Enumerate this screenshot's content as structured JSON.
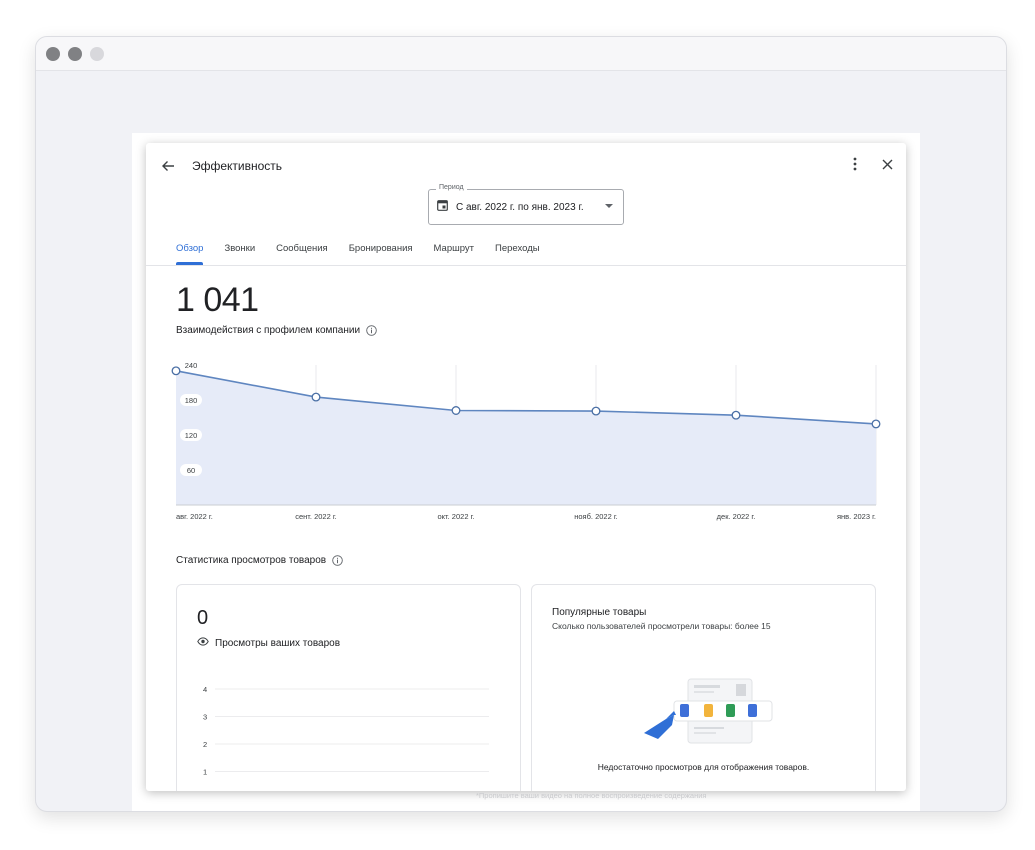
{
  "header": {
    "title": "Эффективность"
  },
  "period": {
    "label": "Период",
    "value": "С авг. 2022 г. по янв. 2023 г."
  },
  "tabs": [
    {
      "label": "Обзор",
      "active": true
    },
    {
      "label": "Звонки"
    },
    {
      "label": "Сообщения"
    },
    {
      "label": "Бронирования"
    },
    {
      "label": "Маршрут"
    },
    {
      "label": "Переходы"
    }
  ],
  "overview": {
    "total": "1 041",
    "label": "Взаимодействия с профилем компании"
  },
  "chart_data": {
    "type": "area",
    "x": [
      "авг. 2022 г.",
      "сент. 2022 г.",
      "окт. 2022 г.",
      "нояб. 2022 г.",
      "дек. 2022 г.",
      "янв. 2023 г."
    ],
    "values": [
      230,
      185,
      162,
      161,
      154,
      139
    ],
    "yticks": [
      240,
      180,
      120,
      60
    ],
    "ylim": [
      0,
      240
    ],
    "color": "#5f86c0",
    "fill": "#e6ebf8"
  },
  "products": {
    "section_title": "Статистика просмотров товаров",
    "views_count": "0",
    "views_label": "Просмотры ваших товаров",
    "mini_yticks": [
      "4",
      "3",
      "2",
      "1"
    ],
    "popular_title": "Популярные товары",
    "popular_sub": "Сколько пользователей просмотрели товары: более 15",
    "no_data": "Недостаточно просмотров для отображения товаров."
  },
  "footer_hint": "*Пропишите ваши видео на полное воспроизведение содержания"
}
